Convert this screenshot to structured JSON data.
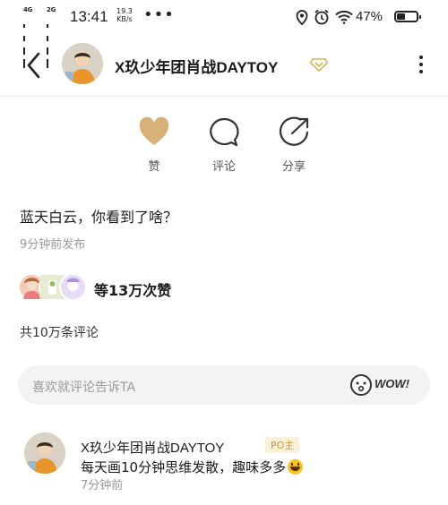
{
  "status_bar": {
    "net1": "4G",
    "net2": "2G",
    "time": "13:41",
    "speed_value": "19.3",
    "speed_unit": "KB/s",
    "more": "•••",
    "battery_pct": "47%",
    "battery_level": 0.47
  },
  "header": {
    "name": "X玖少年团肖战DAYTOY",
    "badge_color": "#d8b25a"
  },
  "actions": {
    "like": "赞",
    "comment": "评论",
    "share": "分享",
    "like_color": "#d8b079"
  },
  "post": {
    "text": "蓝天白云，你看到了啥？",
    "time": "9分钟前发布"
  },
  "likes": {
    "text": "等13万次赞"
  },
  "comments": {
    "count_text": "共10万条评论",
    "placeholder": "喜欢就评论告诉TA",
    "wow": "WOW!"
  },
  "comment_item": {
    "name": "X玖少年团肖战DAYTOY",
    "badge": "PO主",
    "text": "每天画10分钟思维发散，趣味多多",
    "time": "7分钟前"
  }
}
